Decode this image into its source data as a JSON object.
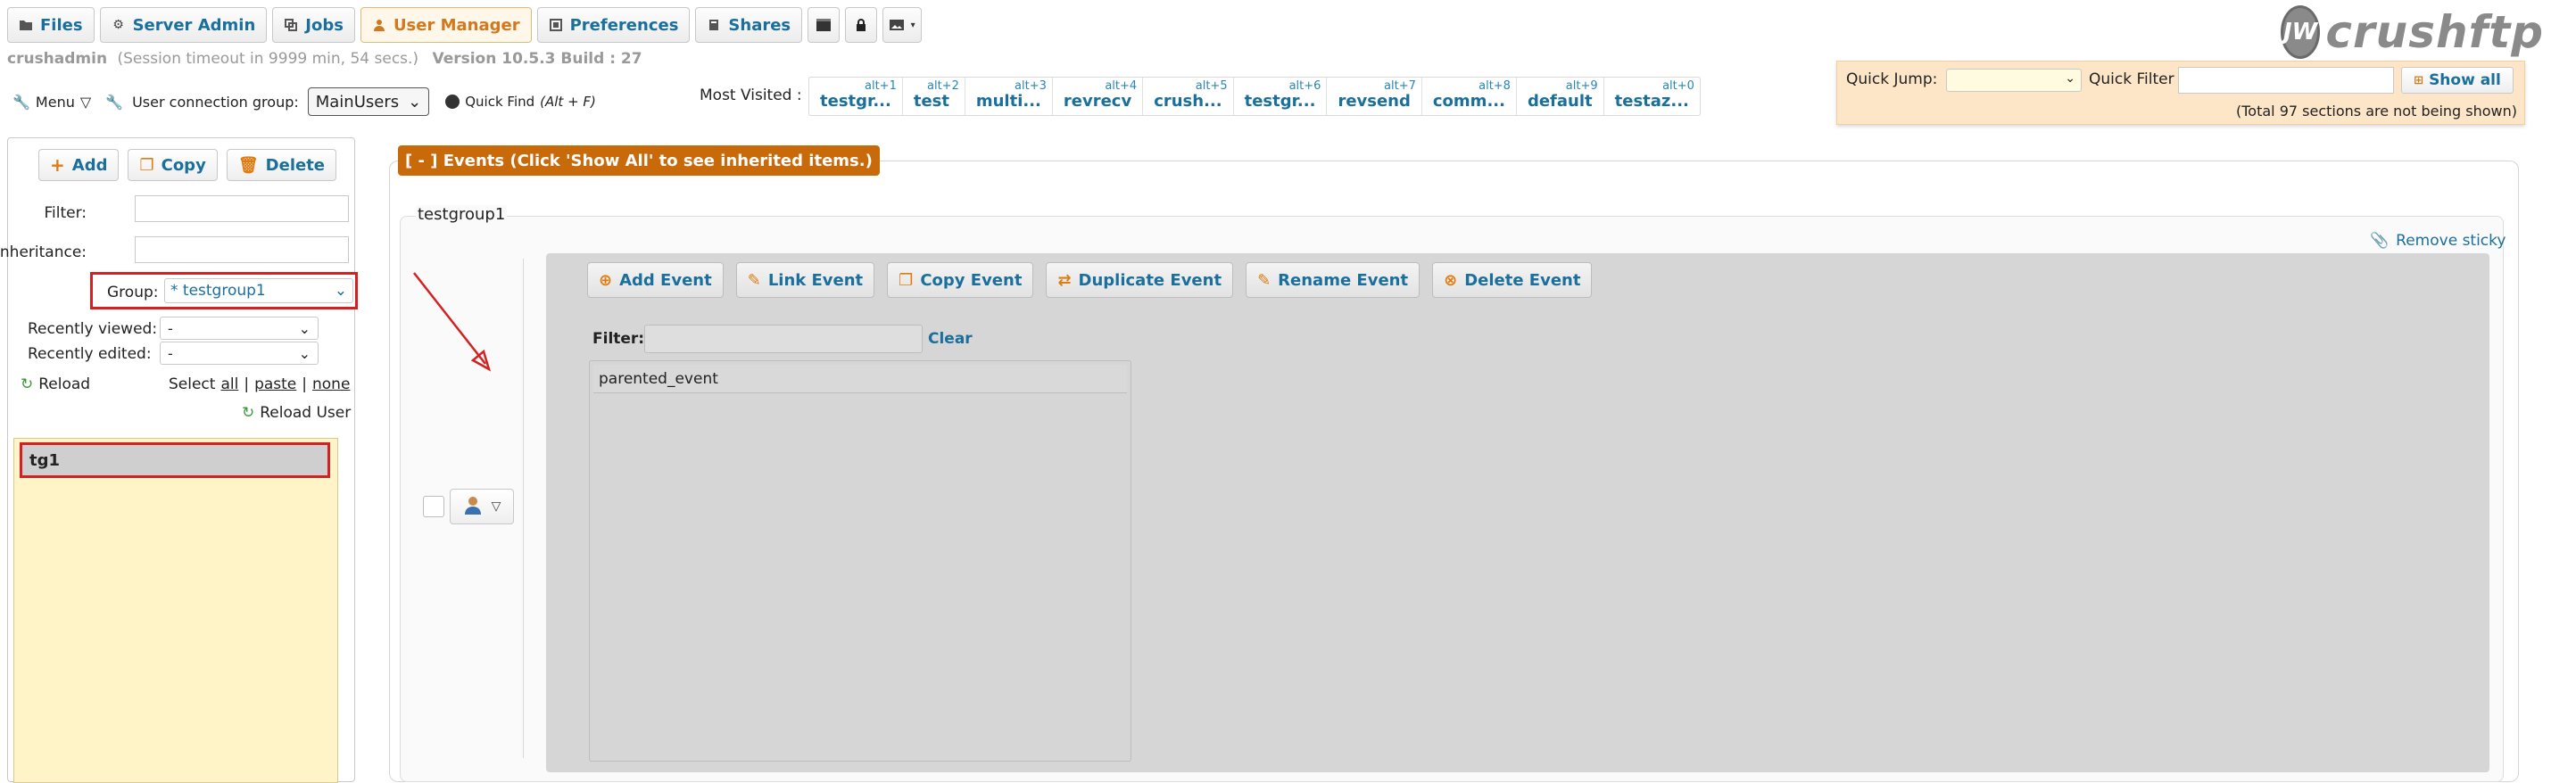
{
  "tabs": [
    {
      "label": "Files",
      "icon": "folder-icon"
    },
    {
      "label": "Server Admin",
      "icon": "gear-icon"
    },
    {
      "label": "Jobs",
      "icon": "jobs-icon"
    },
    {
      "label": "User Manager",
      "icon": "user-icon",
      "active": true
    },
    {
      "label": "Preferences",
      "icon": "preferences-icon"
    },
    {
      "label": "Shares",
      "icon": "shares-icon"
    }
  ],
  "session": {
    "user": "crushadmin",
    "timeout": "(Session timeout in 9999 min, 54 secs.)",
    "version": "Version 10.5.3 Build : 27"
  },
  "toolbar": {
    "menu_label": "Menu",
    "connection_group_label": "User connection group:",
    "connection_group_value": "MainUsers",
    "quick_find_label": "Quick Find",
    "quick_find_shortcut": "(Alt + F)"
  },
  "most_visited": {
    "label": "Most Visited :",
    "items": [
      {
        "key": "alt+1",
        "label": "testgr..."
      },
      {
        "key": "alt+2",
        "label": "test"
      },
      {
        "key": "alt+3",
        "label": "multi..."
      },
      {
        "key": "alt+4",
        "label": "revrecv"
      },
      {
        "key": "alt+5",
        "label": "crush..."
      },
      {
        "key": "alt+6",
        "label": "testgr..."
      },
      {
        "key": "alt+7",
        "label": "revsend"
      },
      {
        "key": "alt+8",
        "label": "comm..."
      },
      {
        "key": "alt+9",
        "label": "default"
      },
      {
        "key": "alt+0",
        "label": "testaz..."
      }
    ]
  },
  "logo": {
    "mark": "JW",
    "text": "crushftp"
  },
  "quick": {
    "jump_label": "Quick Jump:",
    "filter_label": "Quick Filter",
    "show_all_label": "Show all",
    "note": "(Total 97 sections are not being shown)"
  },
  "left": {
    "add_label": "Add",
    "copy_label": "Copy",
    "delete_label": "Delete",
    "filter_label": "Filter:",
    "inheritance_label": "Inheritance:",
    "group_label": "Group:",
    "group_value": "* testgroup1",
    "recently_viewed_label": "Recently viewed:",
    "recently_viewed_value": "-",
    "recently_edited_label": "Recently edited:",
    "recently_edited_value": "-",
    "reload_label": "Reload",
    "select_label": "Select",
    "all_label": "all",
    "paste_label": "paste",
    "none_label": "none",
    "separator": "|",
    "reload_user_label": "Reload User",
    "users": [
      "tg1"
    ]
  },
  "main": {
    "events_header": "[ - ] Events (Click 'Show All' to see inherited items.)",
    "group_title": "testgroup1",
    "remove_sticky_label": "Remove sticky",
    "buttons": [
      {
        "label": "Add Event",
        "icon": "add-icon"
      },
      {
        "label": "Link Event",
        "icon": "link-icon"
      },
      {
        "label": "Copy Event",
        "icon": "copy-icon"
      },
      {
        "label": "Duplicate Event",
        "icon": "duplicate-icon"
      },
      {
        "label": "Rename Event",
        "icon": "rename-icon"
      },
      {
        "label": "Delete Event",
        "icon": "delete-icon"
      }
    ],
    "filter_label": "Filter:",
    "clear_label": "Clear",
    "events": [
      "parented_event"
    ]
  },
  "colors": {
    "accent": "#1a6f9c",
    "active_tab": "#d2781e",
    "events_header": "#c86a0a",
    "highlight": "#d32020"
  }
}
